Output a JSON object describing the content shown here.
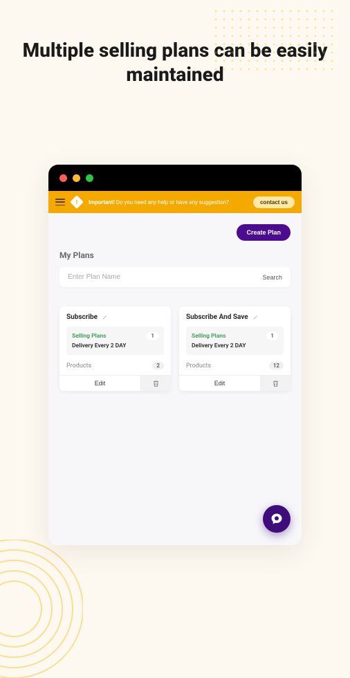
{
  "headline": "Multiple selling plans can be easily maintained",
  "banner": {
    "important": "Important!",
    "message": "Do you need any help or have any suggestion?",
    "contact": "contact us"
  },
  "actions": {
    "create": "Create Plan"
  },
  "section": {
    "title": "My Plans"
  },
  "search": {
    "placeholder": "Enter Plan Name",
    "button": "Search"
  },
  "labels": {
    "selling_plans": "Selling Plans",
    "products": "Products",
    "edit": "Edit"
  },
  "cards": [
    {
      "title": "Subscribe",
      "plans_count": "1",
      "delivery": "Delivery Every 2 DAY",
      "products_count": "2"
    },
    {
      "title": "Subscribe And Save",
      "plans_count": "1",
      "delivery": "Delivery Every 2 DAY",
      "products_count": "12"
    }
  ]
}
